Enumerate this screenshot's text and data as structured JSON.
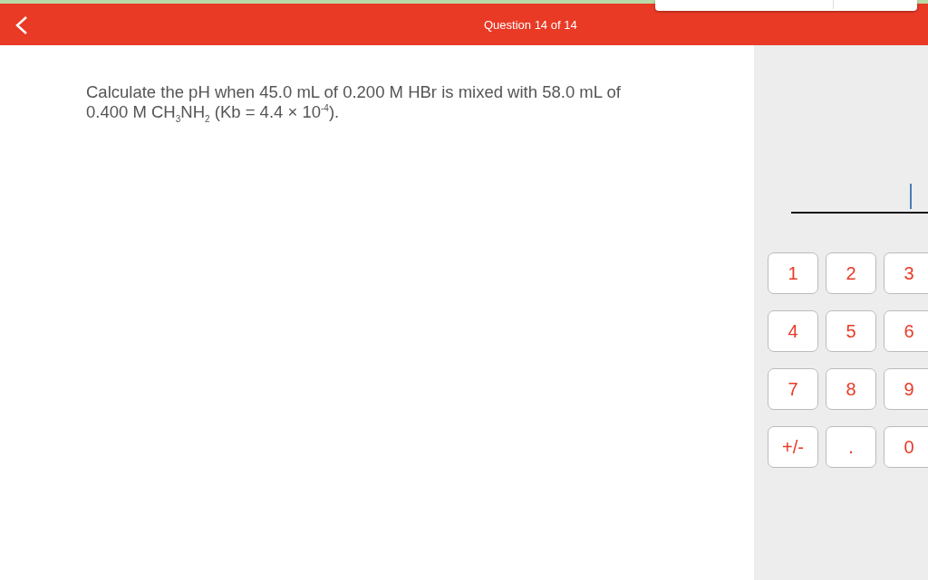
{
  "header": {
    "title": "Question 14 of 14"
  },
  "question": {
    "text": "Calculate the pH when 45.0 mL of 0.200 M HBr is mixed with 58.0 mL of 0.400 M CH$_{3}$NH$_{2}$ (Kb = 4.4 × 10$^{-4}$)."
  },
  "keypad": {
    "keys": [
      "1",
      "2",
      "3",
      "4",
      "5",
      "6",
      "7",
      "8",
      "9",
      "+/-",
      ".",
      "0"
    ]
  }
}
